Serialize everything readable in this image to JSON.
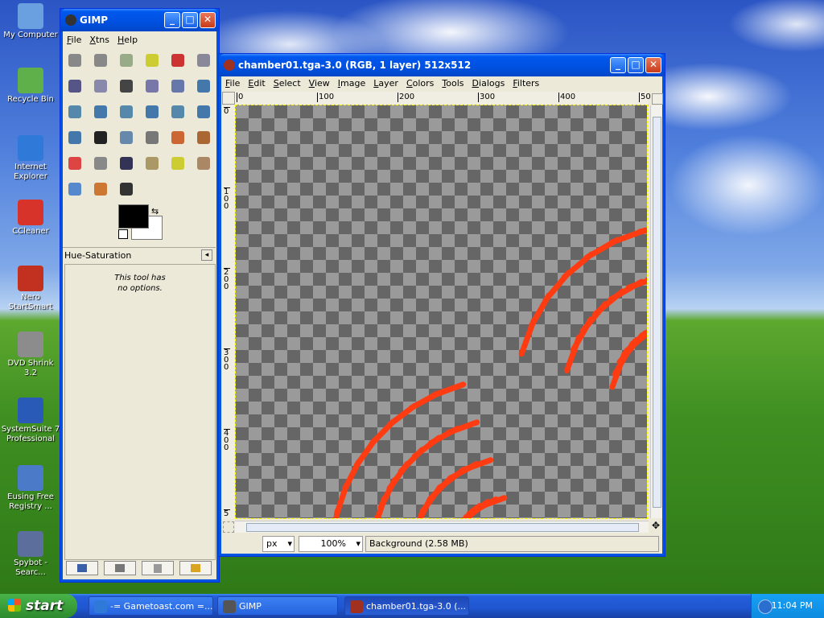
{
  "desktop_icons": [
    {
      "label": "My Computer",
      "name": "my-computer-icon",
      "color": "#6aa0e0"
    },
    {
      "label": "Recycle Bin",
      "name": "recycle-bin-icon",
      "color": "#5fb04a"
    },
    {
      "label": "Internet Explorer",
      "name": "internet-explorer-icon",
      "color": "#2f79d8"
    },
    {
      "label": "CCleaner",
      "name": "ccleaner-icon",
      "color": "#d8332a"
    },
    {
      "label": "Nero StartSmart",
      "name": "nero-icon",
      "color": "#c2311f"
    },
    {
      "label": "DVD Shrink 3.2",
      "name": "dvd-shrink-icon",
      "color": "#8c8c8c"
    },
    {
      "label": "SystemSuite 7 Professional",
      "name": "systemsuite-icon",
      "color": "#2a5ab8"
    },
    {
      "label": "Eusing Free Registry ...",
      "name": "eusing-registry-icon",
      "color": "#4b7bc8"
    },
    {
      "label": "Spybot - Searc...",
      "name": "spybot-icon",
      "color": "#5c6f9c"
    }
  ],
  "gimp_toolbox": {
    "title": "GIMP",
    "menu": [
      "File",
      "Xtns",
      "Help"
    ],
    "tools": [
      "rect-select",
      "ellipse-select",
      "free-select",
      "fuzzy-select",
      "color-select",
      "scissors",
      "paths",
      "foreground-select",
      "color-picker",
      "zoom",
      "measure",
      "move",
      "align",
      "crop",
      "rotate",
      "scale",
      "shear",
      "perspective",
      "flip",
      "text",
      "bucket-fill",
      "blend",
      "pencil",
      "paintbrush",
      "eraser",
      "airbrush",
      "ink",
      "clone",
      "heal",
      "perspective-clone",
      "blur",
      "smudge",
      "dodge-burn"
    ],
    "panel_title": "Hue-Saturation",
    "options_text_1": "This tool has",
    "options_text_2": "no options."
  },
  "image_window": {
    "title": "chamber01.tga-3.0 (RGB, 1 layer) 512x512",
    "menu": [
      "File",
      "Edit",
      "Select",
      "View",
      "Image",
      "Layer",
      "Colors",
      "Tools",
      "Dialogs",
      "Filters"
    ],
    "ruler_labels": [
      "0",
      "100",
      "200",
      "300",
      "400",
      "50"
    ],
    "vruler_labels": [
      "0",
      "100",
      "200",
      "300",
      "400",
      "5"
    ],
    "unit": "px",
    "zoom": "100%",
    "status": "Background (2.58 MB)",
    "stroke_color": "#ff3b12"
  },
  "taskbar": {
    "start_label": "start",
    "items": [
      {
        "label": "-= Gametoast.com =...",
        "active": false
      },
      {
        "label": "GIMP",
        "active": false
      },
      {
        "label": "chamber01.tga-3.0 (...",
        "active": true
      }
    ],
    "clock": "11:04 PM"
  }
}
